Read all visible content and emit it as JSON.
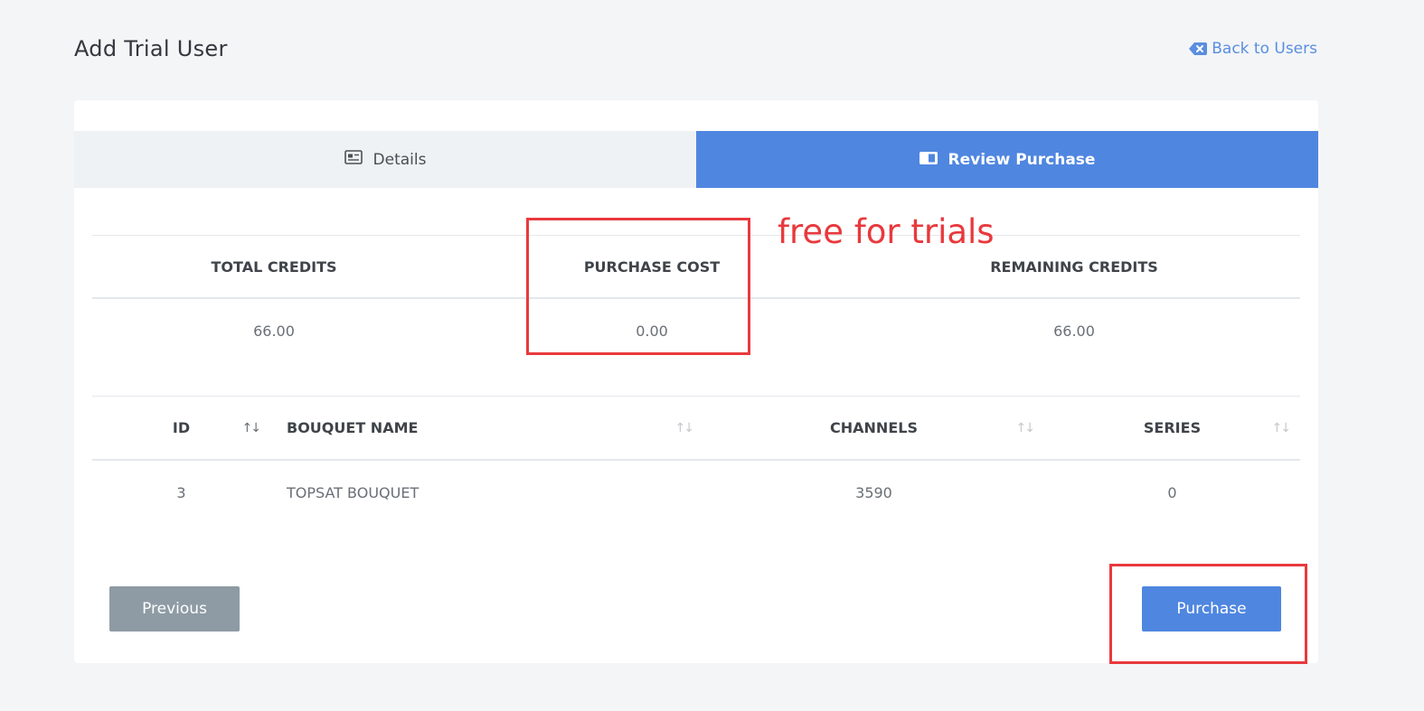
{
  "header": {
    "title": "Add Trial User",
    "back_label": "Back to Users"
  },
  "tabs": [
    {
      "label": "Details",
      "active": false,
      "icon": "id-card-icon"
    },
    {
      "label": "Review Purchase",
      "active": true,
      "icon": "book-icon"
    }
  ],
  "summary": {
    "headers": [
      "TOTAL CREDITS",
      "PURCHASE COST",
      "REMAINING CREDITS"
    ],
    "values": [
      "66.00",
      "0.00",
      "66.00"
    ]
  },
  "bouquets": {
    "columns": [
      "ID",
      "BOUQUET NAME",
      "CHANNELS",
      "SERIES"
    ],
    "sort_icon": "↑↓",
    "rows": [
      {
        "id": "3",
        "name": "TOPSAT BOUQUET",
        "channels": "3590",
        "series": "0"
      }
    ]
  },
  "buttons": {
    "previous": "Previous",
    "purchase": "Purchase"
  },
  "annotation": {
    "text": "free for trials",
    "color": "#e8393d"
  },
  "colors": {
    "accent": "#4f86e0",
    "muted_button": "#8e9ba4",
    "background": "#f3f5f7"
  }
}
